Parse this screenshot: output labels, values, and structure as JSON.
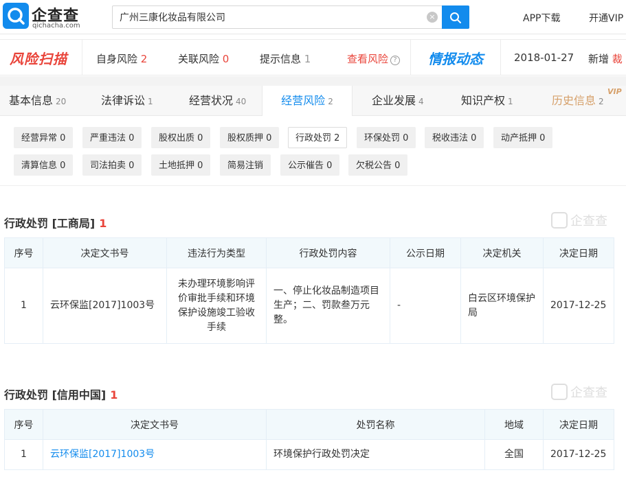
{
  "header": {
    "logo_cn": "企查查",
    "logo_en": "qichacha.com",
    "search_value": "广州三康化妆品有限公司",
    "clear_icon": "×",
    "app_download": "APP下载",
    "open_vip": "开通VIP"
  },
  "risk_bar": {
    "logo": "风险扫描",
    "self_risk_label": "自身风险",
    "self_risk_count": "2",
    "related_risk_label": "关联风险",
    "related_risk_count": "0",
    "hint_label": "提示信息",
    "hint_count": "1",
    "check_risk": "查看风险",
    "help_icon": "?",
    "intel_logo": "情报动态",
    "intel_date": "2018-01-27",
    "intel_new_label": "新增",
    "intel_new_value": "裁"
  },
  "tabs": [
    {
      "label": "基本信息",
      "count": "20"
    },
    {
      "label": "法律诉讼",
      "count": "1"
    },
    {
      "label": "经营状况",
      "count": "40"
    },
    {
      "label": "经营风险",
      "count": "2"
    },
    {
      "label": "企业发展",
      "count": "4"
    },
    {
      "label": "知识产权",
      "count": "1"
    },
    {
      "label": "历史信息",
      "count": "2"
    }
  ],
  "vip_badge": "VIP",
  "filters": [
    "经营异常 0",
    "严重违法 0",
    "股权出质 0",
    "股权质押 0",
    "行政处罚 2",
    "环保处罚 0",
    "税收违法 0",
    "动产抵押 0",
    "清算信息 0",
    "司法拍卖 0",
    "土地抵押 0",
    "简易注销",
    "公示催告 0",
    "欠税公告 0"
  ],
  "section1": {
    "title": "行政处罚 [工商局]",
    "count": "1",
    "watermark": "企查查",
    "headers": [
      "序号",
      "决定文书号",
      "违法行为类型",
      "行政处罚内容",
      "公示日期",
      "决定机关",
      "决定日期"
    ],
    "row": {
      "no": "1",
      "doc_no": "云环保监[2017]1003号",
      "violation": "未办理环境影响评价审批手续和环境保护设施竣工验收手续",
      "content": "一、停止化妆品制造项目生产；二、罚款叁万元整。",
      "publish_date": "-",
      "authority": "白云区环境保护局",
      "decision_date": "2017-12-25"
    }
  },
  "section2": {
    "title": "行政处罚 [信用中国]",
    "count": "1",
    "watermark": "企查查",
    "headers": [
      "序号",
      "决定文书号",
      "处罚名称",
      "地域",
      "决定日期"
    ],
    "row": {
      "no": "1",
      "doc_no": "云环保监[2017]1003号",
      "name": "环境保护行政处罚决定",
      "region": "全国",
      "decision_date": "2017-12-25"
    }
  },
  "colors": {
    "brand_blue": "#128bed",
    "risk_red": "#e9443a",
    "vip_gold": "#d6a06a"
  }
}
